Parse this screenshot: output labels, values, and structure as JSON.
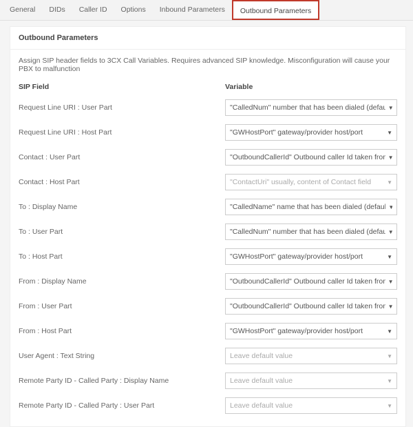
{
  "tabs": {
    "general": "General",
    "dids": "DIDs",
    "callerid": "Caller ID",
    "options": "Options",
    "inbound": "Inbound Parameters",
    "outbound": "Outbound Parameters",
    "active": "outbound"
  },
  "panel": {
    "title": "Outbound Parameters",
    "description": "Assign SIP header fields to 3CX Call Variables. Requires advanced SIP knowledge. Misconfiguration will cause your PBX to malfunction",
    "header_label": "SIP Field",
    "header_value": "Variable"
  },
  "fields": {
    "req_user": {
      "label": "Request Line URI : User Part",
      "value": "\"CalledNum\" number that has been dialed (default: To->user)",
      "placeholder": false
    },
    "req_host": {
      "label": "Request Line URI : Host Part",
      "value": "\"GWHostPort\" gateway/provider host/port",
      "placeholder": false
    },
    "contact_user": {
      "label": "Contact : User Part",
      "value": "\"OutboundCallerId\" Outbound caller Id taken from Extension",
      "placeholder": false
    },
    "contact_host": {
      "label": "Contact : Host Part",
      "value": "\"ContactUri\" usually, content of Contact field",
      "placeholder": true
    },
    "to_display": {
      "label": "To : Display Name",
      "value": "\"CalledName\" name that has been dialed (default: To->displayname)",
      "placeholder": false
    },
    "to_user": {
      "label": "To : User Part",
      "value": "\"CalledNum\" number that has been dialed (default: To->user)",
      "placeholder": false
    },
    "to_host": {
      "label": "To : Host Part",
      "value": "\"GWHostPort\" gateway/provider host/port",
      "placeholder": false
    },
    "from_display": {
      "label": "From : Display Name",
      "value": "\"OutboundCallerId\" Outbound caller Id taken from Extension",
      "placeholder": false
    },
    "from_user": {
      "label": "From : User Part",
      "value": "\"OutboundCallerId\" Outbound caller Id taken from Extension",
      "placeholder": false
    },
    "from_host": {
      "label": "From : Host Part",
      "value": "\"GWHostPort\" gateway/provider host/port",
      "placeholder": false
    },
    "user_agent": {
      "label": "User Agent : Text String",
      "value": "Leave default value",
      "placeholder": true
    },
    "rpid_called_display": {
      "label": "Remote Party ID - Called Party : Display Name",
      "value": "Leave default value",
      "placeholder": true
    },
    "rpid_called_user": {
      "label": "Remote Party ID - Called Party : User Part",
      "value": "Leave default value",
      "placeholder": true
    }
  }
}
